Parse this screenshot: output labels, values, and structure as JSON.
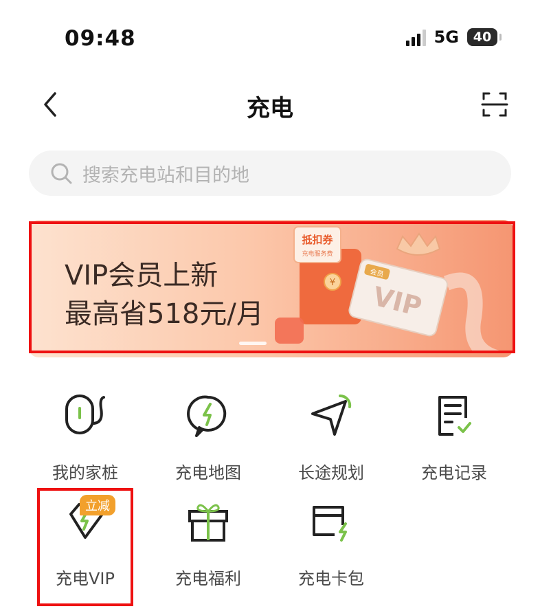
{
  "status_bar": {
    "time": "09:48",
    "network": "5G",
    "battery": "40"
  },
  "nav": {
    "title": "充电",
    "back_icon": "chevron-left-icon",
    "scan_icon": "scan-icon"
  },
  "search": {
    "placeholder": "搜索充电站和目的地"
  },
  "banner": {
    "line1": "VIP会员上新",
    "line2": "最高省518元/月",
    "coupon_title": "抵扣券",
    "coupon_sub": "充电服务费",
    "coupon_currency": "¥",
    "card_text": "VIP",
    "card_tag": "会员"
  },
  "services": [
    {
      "label": "我的家桩",
      "icon": "home-charger-icon"
    },
    {
      "label": "充电地图",
      "icon": "map-pin-charge-icon"
    },
    {
      "label": "长途规划",
      "icon": "navigation-icon"
    },
    {
      "label": "充电记录",
      "icon": "record-icon"
    },
    {
      "label": "充电VIP",
      "icon": "vip-diamond-icon",
      "badge": "立减"
    },
    {
      "label": "充电福利",
      "icon": "gift-icon"
    },
    {
      "label": "充电卡包",
      "icon": "card-wallet-icon"
    }
  ],
  "colors": {
    "accent_green": "#7bc24a",
    "badge_orange": "#f2a02c",
    "highlight_red": "#ee1111"
  }
}
